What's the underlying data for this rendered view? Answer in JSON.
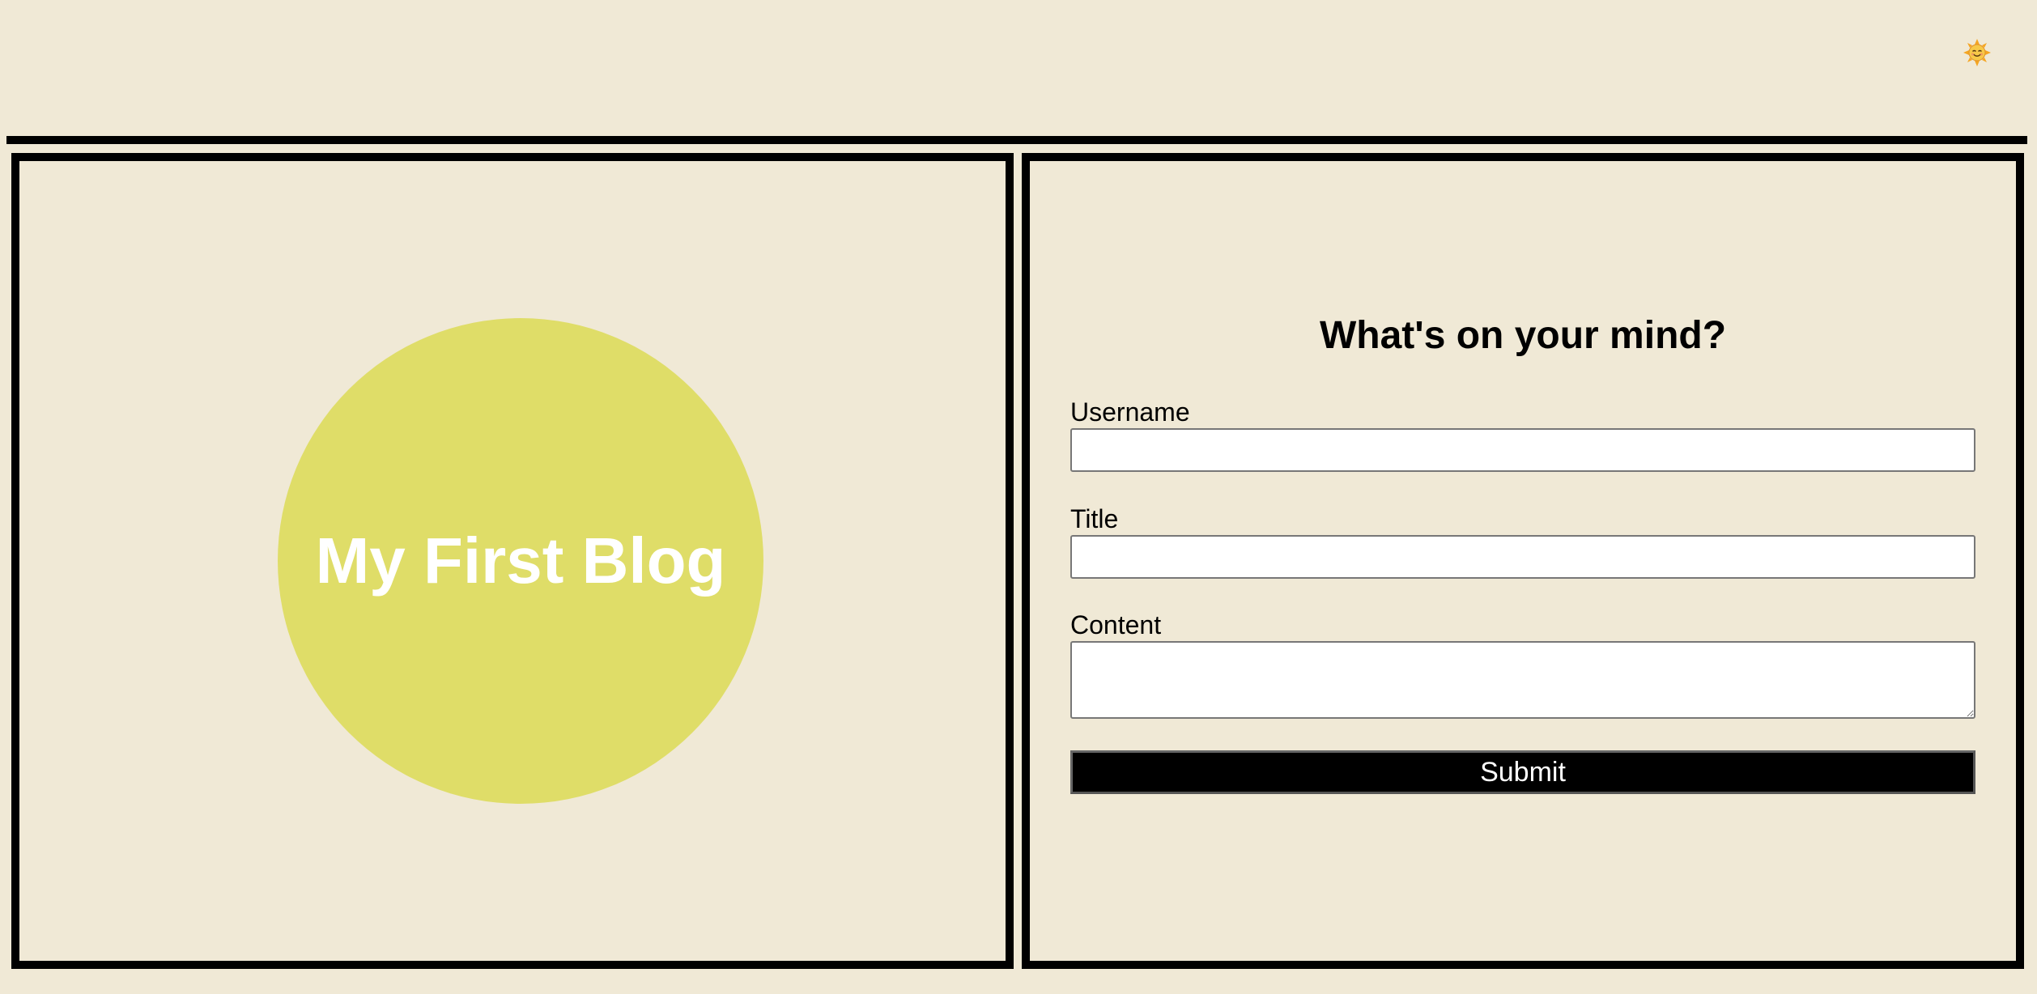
{
  "header": {
    "theme_toggle_icon": "sun-face-icon"
  },
  "hero": {
    "title": "My First Blog",
    "circle_color": "#dfdd68"
  },
  "form": {
    "heading": "What's on your mind?",
    "username_label": "Username",
    "username_value": "",
    "title_label": "Title",
    "title_value": "",
    "content_label": "Content",
    "content_value": "",
    "submit_label": "Submit"
  },
  "colors": {
    "background": "#f0e9d6",
    "border": "#000000",
    "button_bg": "#000000",
    "button_text": "#ffffff"
  }
}
